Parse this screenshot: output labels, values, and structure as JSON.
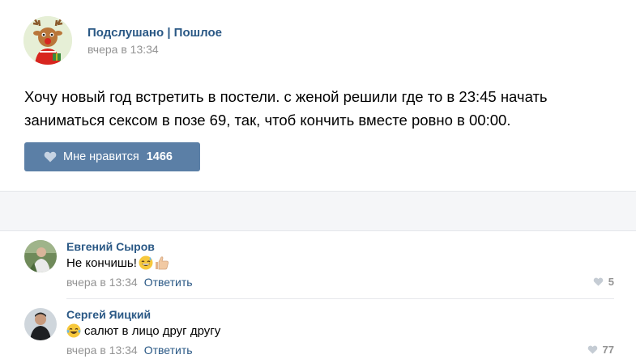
{
  "post": {
    "author": "Подслушано | Пошлое",
    "time": "вчера в 13:34",
    "text": "Хочу новый год встретить в постели. с женой решили где то в 23:45 начать заниматься сексом в позе 69, так, чтоб кончить вместе ровно в 00:00.",
    "like_label": "Мне нравится",
    "like_count": "1466"
  },
  "comments": [
    {
      "author": "Евгений Сыров",
      "text": "Не кончишь!",
      "time": "вчера в 13:34",
      "reply": "Ответить",
      "likes": "5",
      "emoji": [
        "grinning-face-sweat",
        "thumbs-up"
      ]
    },
    {
      "author": "Сергей Яицкий",
      "text": "салют в лицо друг другу",
      "time": "вчера в 13:34",
      "reply": "Ответить",
      "likes": "77",
      "emoji": [
        "face-with-tears-of-joy"
      ]
    }
  ],
  "colors": {
    "link": "#2a5885",
    "like_button": "#5b7fa6",
    "muted": "#939393",
    "band": "#f5f6f8"
  }
}
